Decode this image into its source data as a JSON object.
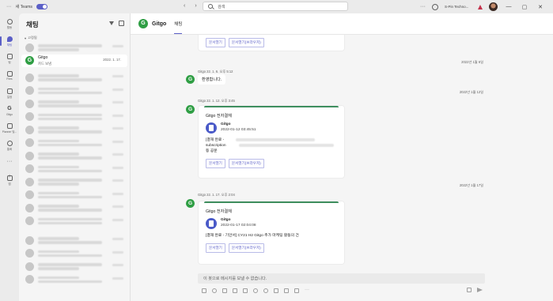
{
  "titlebar": {
    "new_teams_label": "새 Teams",
    "search_placeholder": "검색",
    "org_name": "S-Pin Techno...",
    "more": "···",
    "window_controls": [
      "—",
      "▢",
      "✕"
    ]
  },
  "rail": {
    "items": [
      {
        "label": "활동",
        "icon": "bell-icon"
      },
      {
        "label": "채팅",
        "icon": "chat-icon",
        "active": true
      },
      {
        "label": "팀",
        "icon": "teams-icon"
      },
      {
        "label": "Files",
        "icon": "files-icon"
      },
      {
        "label": "일정",
        "icon": "calendar-icon"
      },
      {
        "label": "Gitgo",
        "icon": "gitgo-icon"
      },
      {
        "label": "Planner 및...",
        "icon": "planner-icon"
      },
      {
        "label": "통화",
        "icon": "phone-icon"
      },
      {
        "label": "",
        "icon": "more-icon"
      },
      {
        "label": "앱",
        "icon": "apps-icon"
      }
    ]
  },
  "chatlist": {
    "title": "채팅",
    "section_pinned": "고정됨",
    "selected_chat": {
      "name": "Gitgo",
      "preview": "카드 보냄",
      "date": "2022. 1. 17."
    }
  },
  "main": {
    "chat_name": "Gitgo",
    "tab_label": "채팅",
    "card_buttons": {
      "open": "문서열기",
      "open_browser": "문서열기(브라우저)"
    },
    "date_separators": [
      "2022년 1월 6일",
      "2022년 1월 12일",
      "2022년 1월 17일"
    ],
    "msg_welcome": {
      "meta": "Gitgo   22. 1. 6. 오후 5:12",
      "text": "환영합니다."
    },
    "msg_card1": {
      "meta": "Gitgo   22. 1. 12. 오후 3:45",
      "title": "Gitgo 전자결재",
      "app_name": "Gitgo",
      "app_time": "2022-01-12 03:45:51",
      "body_line1": "[결재 완료 -",
      "body_line2": "subscription",
      "body_line3": "등 공문"
    },
    "msg_card2": {
      "meta": "Gitgo   22. 1. 17. 오후 2:04",
      "title": "Gitgo 전자결재",
      "app_name": "Gitgo",
      "app_time": "2022-01-17 02:04:08",
      "body": "[결재 완료 - 기안서] CY21 H2 Gitgo 추가 마케팅 활동의 건"
    },
    "compose_placeholder": "이 봇으로 메시지를 보낼 수 없습니다."
  }
}
